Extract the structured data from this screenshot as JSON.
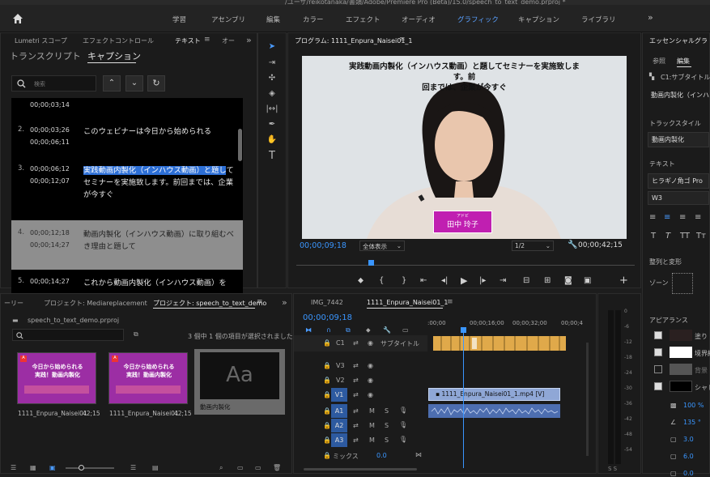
{
  "title_bar": {
    "path": "/ユーザ/reikotanaka/書類/Adobe/Premiere Pro (Beta)/15.0/speech_to_text_demo.prproj *"
  },
  "workspaces": [
    "学習",
    "アセンブリ",
    "編集",
    "カラー",
    "エフェクト",
    "オーディオ",
    "グラフィック",
    "キャプション",
    "ライブラリ"
  ],
  "active_workspace": "グラフィック",
  "left_panel": {
    "tabs": [
      "Lumetri スコープ",
      "エフェクトコントロール",
      "テキスト",
      "オー"
    ],
    "subtabs": [
      "トランスクリプト",
      "キャプション"
    ],
    "search_placeholder": "検索",
    "captions": [
      {
        "n": "",
        "in": "00;00;03;14",
        "out": "",
        "text": ""
      },
      {
        "n": "2.",
        "in": "00;00;03;26",
        "out": "00;00;06;11",
        "text": "このウェビナーは今日から始められる"
      },
      {
        "n": "3.",
        "in": "00;00;06;12",
        "out": "00;00;12;07",
        "text_hl": "実践動画内製化（インハウス動画）と題し",
        "text": "てセミナーを実施致します。前回までは、企業が今すぐ"
      },
      {
        "n": "4.",
        "in": "00;00;12;18",
        "out": "00;00;14;27",
        "text": "動画内製化（インハウス動画）に取り組むべき理由と題して"
      },
      {
        "n": "5.",
        "in": "00;00;14;27",
        "out": "",
        "text": "これから動画内製化（インハウス動画）を"
      }
    ]
  },
  "program_monitor": {
    "title": "プログラム: 1111_Enpura_Naisei01_1",
    "caption_line1": "実践動画内製化（インハウス動画）と題してセミナーを実施致します。前",
    "caption_line2": "回までは、企業が今すぐ",
    "nameplate_small": "アドビ",
    "nameplate_name": "田中 玲子",
    "timecode": "00;00;09;18",
    "fit": "全体表示",
    "quality": "1/2",
    "duration": "00;00;42;15",
    "playhead_fraction": 0.22
  },
  "essential_graphics": {
    "title": "エッセンシャルグラ",
    "tabs": [
      "参照",
      "編集"
    ],
    "layer": "C1:サブタイトル",
    "layer_text": "動画内製化（インハ",
    "track_style_label": "トラックスタイル",
    "track_style_value": "動画内製化",
    "text_label": "テキスト",
    "font": "ヒラギノ角ゴ Pro",
    "weight": "W3",
    "align_label": "整列と変形",
    "zone_label": "ゾーン",
    "appearance_label": "アピアランス",
    "appearance_items": [
      "塗り",
      "境界線",
      "背景",
      "シャド"
    ],
    "opacity": "100 %",
    "angle": "135 °",
    "val1": "3.0",
    "val2": "6.0",
    "val3": "0.0"
  },
  "project_panel": {
    "tabs": [
      "ーリー",
      "プロジェクト: Mediareplacement",
      "プロジェクト: speech_to_text_demo"
    ],
    "file": "speech_to_text_demo.prproj",
    "selection_info": "3 個中 1 個の項目が選択されました",
    "items": [
      {
        "name": "1111_Enpura_Naisei01",
        "dur": "42;15",
        "line1": "今日から始められる",
        "line2": "実践！動画内製化"
      },
      {
        "name": "1111_Enpura_Naisei01",
        "dur": "42;15",
        "line1": "今日から始められる",
        "line2": "実践！動画内製化"
      },
      {
        "name": "動画内製化",
        "dur": "",
        "glyph": "Aa"
      }
    ]
  },
  "timeline": {
    "tabs": [
      "IMG_7442",
      "1111_Enpura_Naisei01_1"
    ],
    "timecode": "00;00;09;18",
    "ruler": [
      ":00;00",
      "00;00;16;00",
      "00;00;32;00",
      "00;00;4"
    ],
    "subtitle_track": "サブタイトル",
    "subtitle_id": "C1",
    "tracks_video": [
      "V3",
      "V2",
      "V1"
    ],
    "tracks_audio": [
      "A1",
      "A2",
      "A3"
    ],
    "clip_name": "1111_Enpura_Naisei01_1.mp4 [V]",
    "mix_label": "ミックス",
    "mix_value": "0.0",
    "playhead_fraction": 0.22
  },
  "audio_meter": {
    "labels": [
      "0",
      "-6",
      "-12",
      "-18",
      "-24",
      "-30",
      "-36",
      "-42",
      "-48",
      "-54"
    ],
    "footer": "S S"
  },
  "colors": {
    "accent": "#2d8cff",
    "caption_clip": "#e0a94a",
    "video_clip": "#8fa7d6",
    "audio_clip": "#4d6eb0",
    "plate": "#c01fb1"
  }
}
